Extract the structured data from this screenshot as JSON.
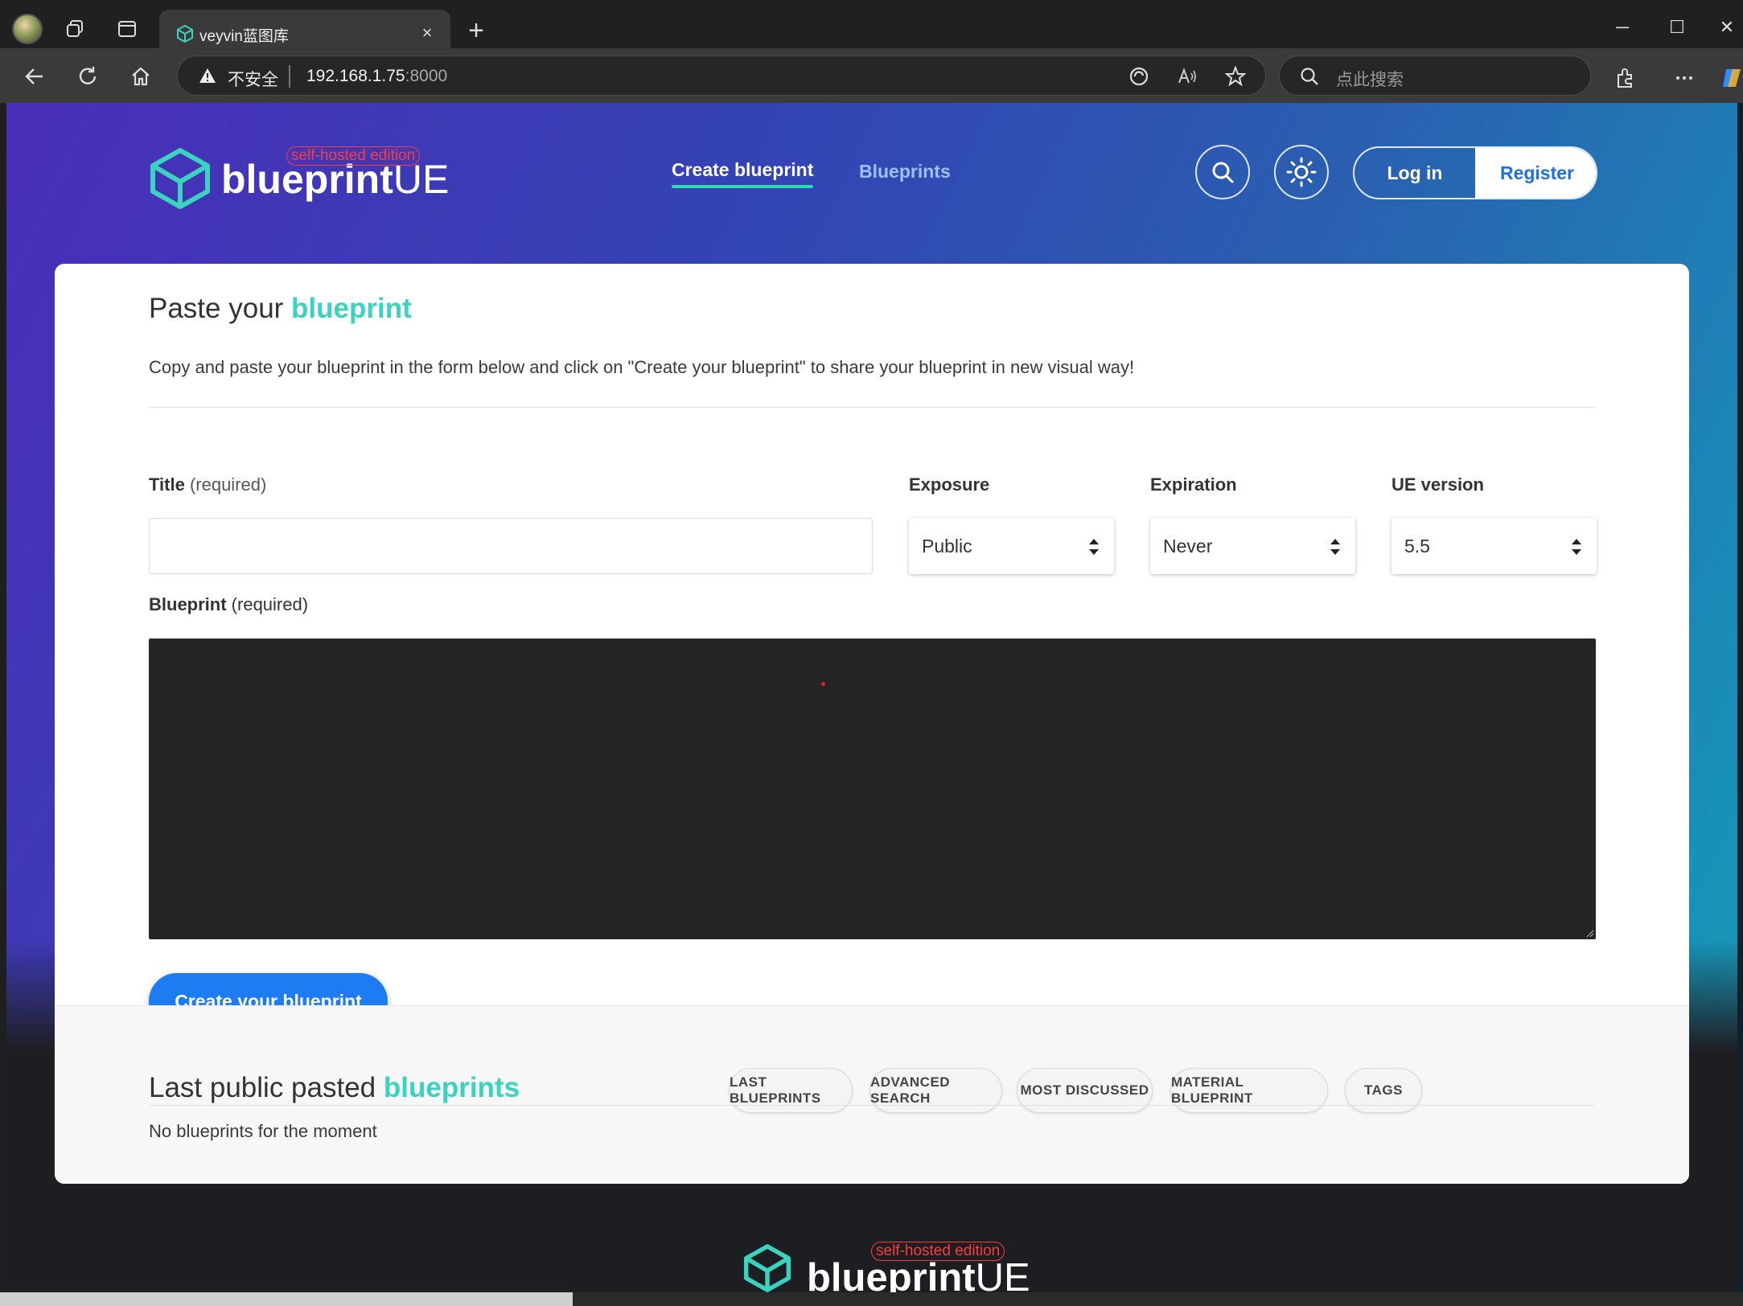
{
  "browser": {
    "tab_title": "veyvin蓝图库",
    "security_label": "不安全",
    "url_host": "192.168.1.75",
    "url_port": ":8000",
    "search_placeholder": "点此搜索",
    "window_controls": {
      "minimize": "─",
      "maximize": "☐",
      "close": "✕"
    },
    "new_tab_label": "+",
    "tab_close_label": "×"
  },
  "header": {
    "logo_text": "blueprint",
    "logo_suffix": "UE",
    "edition_badge": "self-hosted edition",
    "nav": {
      "create": "Create blueprint",
      "blueprints": "Blueprints"
    },
    "login": "Log in",
    "register": "Register"
  },
  "form": {
    "title_prefix": "Paste your ",
    "title_accent": "blueprint",
    "intro": "Copy and paste your blueprint in the form below and click on \"Create your blueprint\" to share your blueprint in new visual way!",
    "title_label": "Title",
    "required": " (required)",
    "title_value": "",
    "exposure_label": "Exposure",
    "exposure_value": "Public",
    "expiration_label": "Expiration",
    "expiration_value": "Never",
    "ue_version_label": "UE version",
    "ue_version_value": "5.5",
    "blueprint_label": "Blueprint",
    "blueprint_value": "",
    "submit": "Create your blueprint"
  },
  "last": {
    "title_prefix": "Last public pasted ",
    "title_accent": "blueprints",
    "filters": [
      "LAST BLUEPRINTS",
      "ADVANCED SEARCH",
      "MOST DISCUSSED",
      "MATERIAL BLUEPRINT",
      "TAGS"
    ],
    "empty": "No blueprints for the moment"
  },
  "footer": {
    "logo_text": "blueprint",
    "logo_suffix": "UE",
    "edition_badge": "self-hosted edition"
  },
  "colors": {
    "accent": "#3ad3c0",
    "primary_button": "#1e7cf2",
    "editor_bg": "#242424",
    "edition_red": "#ff3a3a"
  }
}
